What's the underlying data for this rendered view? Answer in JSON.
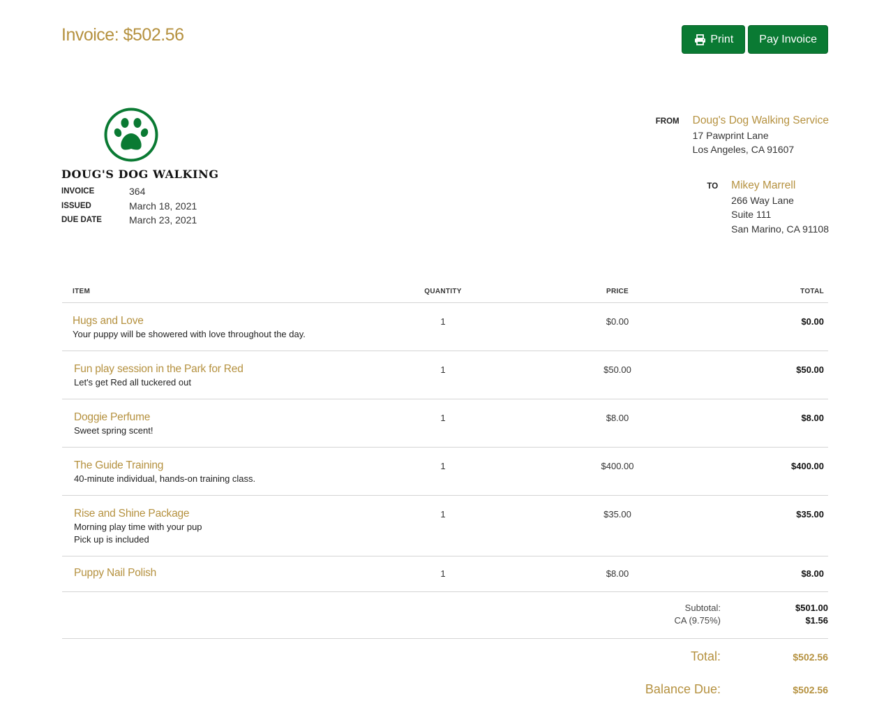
{
  "header": {
    "title": "Invoice: $502.56",
    "print_label": "Print",
    "pay_label": "Pay Invoice"
  },
  "brand": {
    "name": "DOUG'S DOG WALKING",
    "logo_icon": "paw-icon",
    "accent_color": "#0a7a33"
  },
  "meta": [
    {
      "label": "INVOICE",
      "value": "364"
    },
    {
      "label": "ISSUED",
      "value": "March 18, 2021"
    },
    {
      "label": "DUE DATE",
      "value": "March 23, 2021"
    }
  ],
  "from": {
    "label": "FROM",
    "name": "Doug's Dog Walking Service",
    "lines": [
      "17 Pawprint Lane",
      "Los Angeles, CA 91607"
    ]
  },
  "to": {
    "label": "TO",
    "name": "Mikey Marrell",
    "lines": [
      "266 Way Lane",
      "Suite 111",
      "San Marino, CA 91108"
    ]
  },
  "table": {
    "headers": {
      "item": "ITEM",
      "quantity": "QUANTITY",
      "price": "PRICE",
      "total": "TOTAL"
    },
    "rows": [
      {
        "name": "Hugs and Love",
        "desc": "Your puppy will be showered with love throughout the day.",
        "qty": "1",
        "price": "$0.00",
        "total": "$0.00"
      },
      {
        "name": "Fun play session in the Park for Red",
        "desc": "Let's get Red all tuckered out",
        "qty": "1",
        "price": "$50.00",
        "total": "$50.00"
      },
      {
        "name": "Doggie Perfume",
        "desc": "Sweet spring scent!",
        "qty": "1",
        "price": "$8.00",
        "total": "$8.00"
      },
      {
        "name": "The Guide Training",
        "desc": "40-minute individual, hands-on training class.",
        "qty": "1",
        "price": "$400.00",
        "total": "$400.00"
      },
      {
        "name": "Rise and Shine Package",
        "desc": "Morning play time with your pup\nPick up is included",
        "qty": "1",
        "price": "$35.00",
        "total": "$35.00"
      },
      {
        "name": "Puppy Nail Polish",
        "desc": "",
        "qty": "1",
        "price": "$8.00",
        "total": "$8.00"
      }
    ]
  },
  "summary": {
    "subtotal_label": "Subtotal:",
    "subtotal_value": "$501.00",
    "tax_label": "CA (9.75%)",
    "tax_value": "$1.56",
    "total_label": "Total:",
    "total_value": "$502.56",
    "balance_label": "Balance Due:",
    "balance_value": "$502.56"
  }
}
